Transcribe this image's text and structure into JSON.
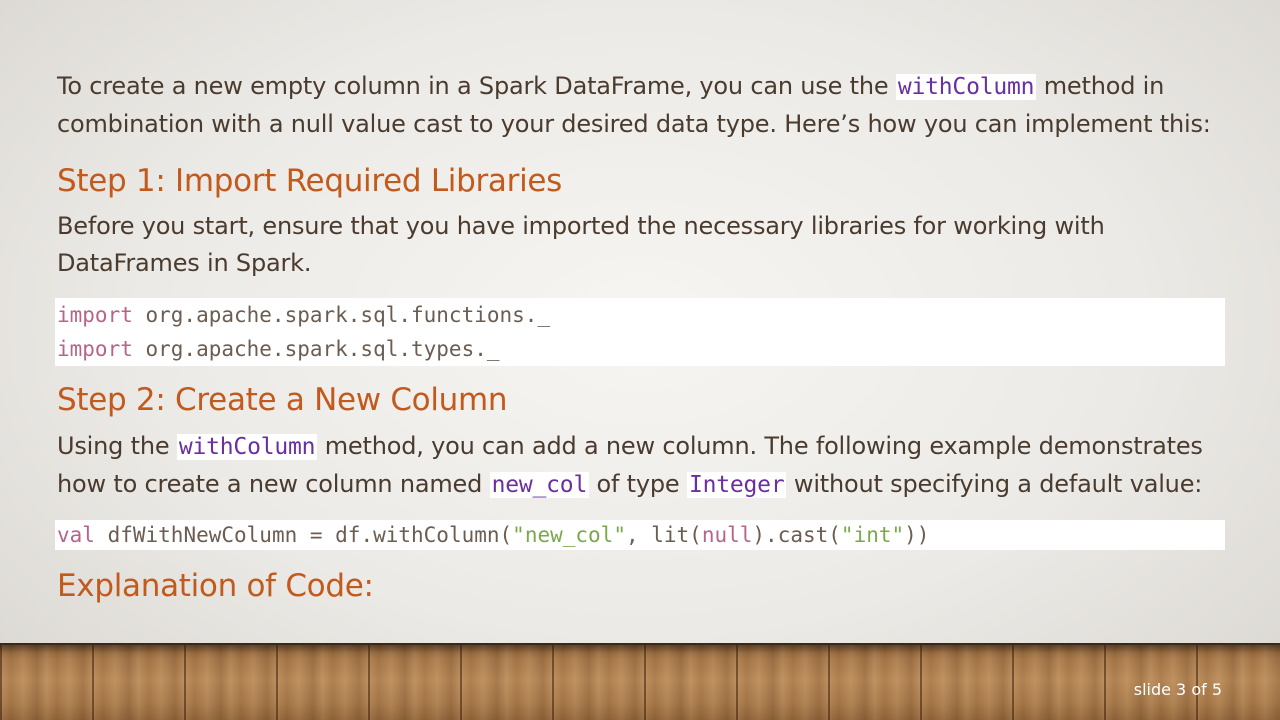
{
  "intro": {
    "part1": "To create a new empty column in a Spark DataFrame, you can use the ",
    "code": "withColumn",
    "part2": " method in combination with a null value cast to your desired data type. Here’s how you can implement this:"
  },
  "step1": {
    "heading": "Step 1: Import Required Libraries",
    "text": "Before you start, ensure that you have imported the necessary libraries for working with DataFrames in Spark.",
    "code_lines": [
      {
        "keyword": "import",
        "rest": " org.apache.spark.sql.functions._"
      },
      {
        "keyword": "import",
        "rest": " org.apache.spark.sql.types._"
      }
    ]
  },
  "step2": {
    "heading": "Step 2: Create a New Column",
    "text_part1": "Using the ",
    "code1": "withColumn",
    "text_part2": " method, you can add a new column. The following example demonstrates how to create a new column named ",
    "code2": "new_col",
    "text_part3": " of type ",
    "code3": "Integer",
    "text_part4": " without specifying a default value:",
    "code": {
      "keyword": "val",
      "seg1": " dfWithNewColumn = df.withColumn(",
      "str1": "\"new_col\"",
      "seg2": ", lit(",
      "null": "null",
      "seg3": ").cast(",
      "str2": "\"int\"",
      "seg4": "))"
    }
  },
  "explanation": {
    "heading": "Explanation of Code:"
  },
  "footer": {
    "slide_number": "slide 3 of 5"
  },
  "colors": {
    "heading": "#c15a1c",
    "body_text": "#4a3b2e",
    "inline_code": "#6a2fa0",
    "code_keyword": "#b8638a",
    "code_string": "#7aa84a"
  }
}
